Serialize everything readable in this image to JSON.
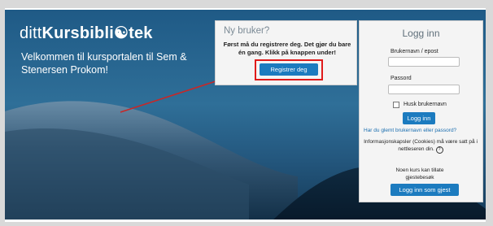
{
  "brand": {
    "prefix": "ditt",
    "bold_a": "Kursbibli",
    "icon": "book-icon",
    "bold_b": "tek"
  },
  "welcome": "Velkommen til kursportalen til Sem & Stenersen Prokom!",
  "new_user": {
    "title": "Ny bruker?",
    "message": "Først må du registrere deg. Det gjør du bare én gang. Klikk på knappen under!",
    "register_label": "Registrer deg"
  },
  "login": {
    "title": "Logg inn",
    "username_label": "Brukernavn / epost",
    "password_label": "Passord",
    "remember_label": "Husk brukernavn",
    "login_button": "Logg inn",
    "forgot_link": "Har du glemt brukernavn eller passord?",
    "cookies_note": "Informasjonskapsler (Cookies) må være satt på i nettleseren din.",
    "help_icon": "question-circle-icon",
    "guest_note": "Noen kurs kan tillate gjestebesøk",
    "guest_button": "Logg inn som gjest"
  },
  "colors": {
    "accent": "#1c7bbf",
    "highlight": "#e01b1b"
  }
}
